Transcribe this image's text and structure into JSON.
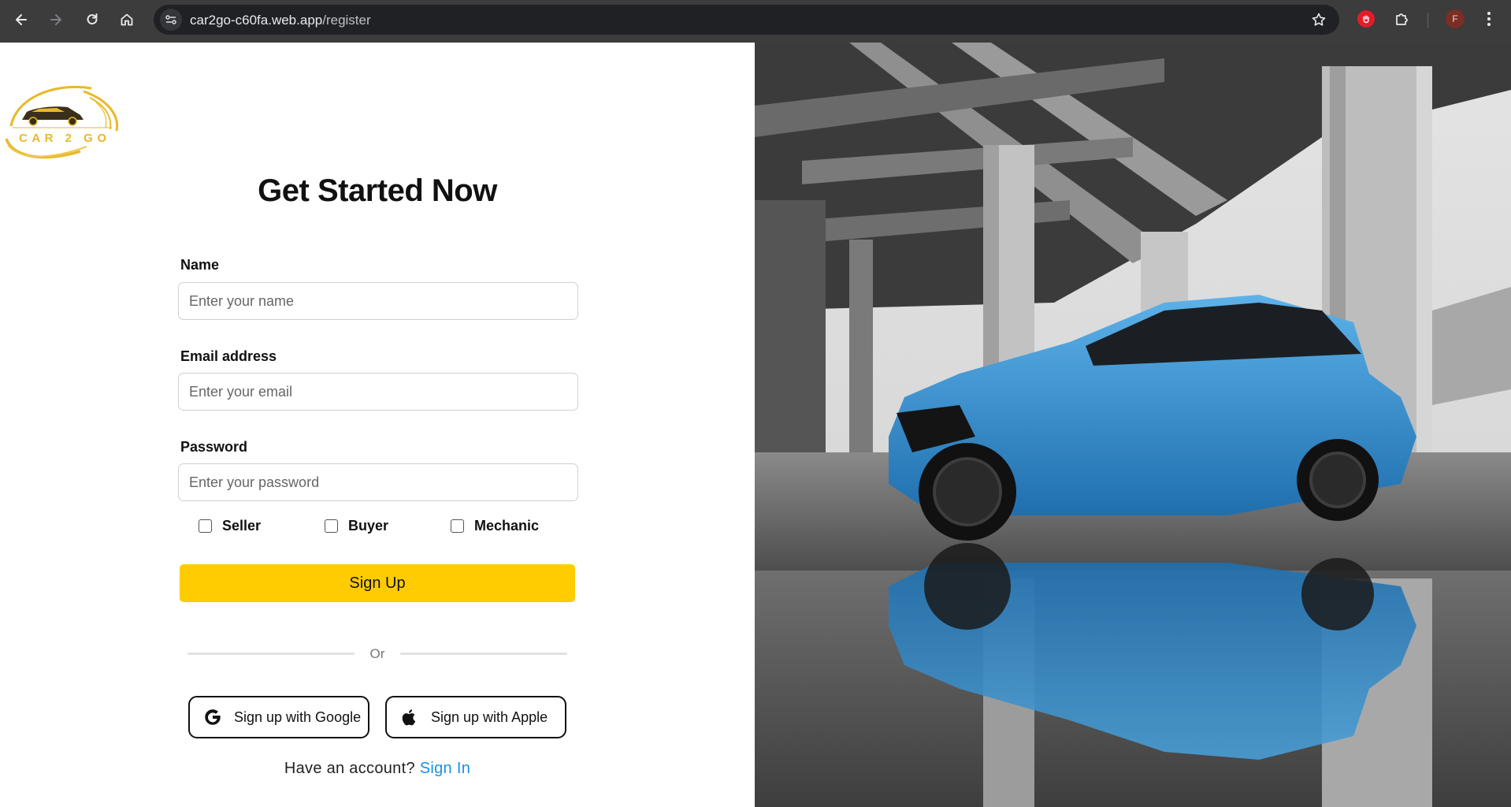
{
  "browser": {
    "url_host": "car2go-c60fa.web.app",
    "url_path": "/register",
    "profile_initial": "F",
    "icons": [
      "back-icon",
      "forward-icon",
      "reload-icon",
      "home-icon",
      "site-info-icon",
      "bookmark-star-icon",
      "extension-red-hand-icon",
      "extensions-puzzle-icon",
      "menu-kebab-icon"
    ]
  },
  "logo": {
    "text": "CAR 2 GO",
    "colors": {
      "gold": "#e8b92a",
      "dark": "#3a2f1a"
    }
  },
  "form": {
    "title": "Get Started Now",
    "name": {
      "label": "Name",
      "placeholder": "Enter your name",
      "value": ""
    },
    "email": {
      "label": "Email address",
      "placeholder": "Enter your email",
      "value": ""
    },
    "password": {
      "label": "Password",
      "placeholder": "Enter your password",
      "value": ""
    },
    "roles": [
      {
        "label": "Seller",
        "checked": false
      },
      {
        "label": "Buyer",
        "checked": false
      },
      {
        "label": "Mechanic",
        "checked": false
      }
    ],
    "submit_label": "Sign Up",
    "divider_text": "Or",
    "google_label": "Sign up with Google",
    "apple_label": "Sign up with Apple",
    "have_account_text": "Have an account?",
    "signin_link": "Sign In"
  },
  "colors": {
    "accent_yellow": "#fecc00",
    "link_blue": "#1a8fe0",
    "chrome_bg": "#3c3c3c",
    "car_blue": "#2f8fd0"
  },
  "hero_image": {
    "subject": "blue hatchback car under concrete overpass with puddle reflection"
  }
}
